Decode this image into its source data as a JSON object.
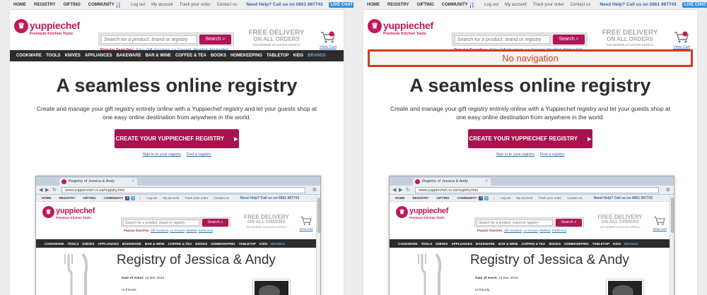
{
  "top_nav": {
    "home": "HOME",
    "registry": "REGISTRY",
    "gifting": "GIFTING",
    "community": "COMMUNITY",
    "log_out": "Log out",
    "my_account": "My account",
    "track_order": "Track your order",
    "contact_us": "Contact us",
    "help": "Need Help? Call us on 0861 987743",
    "live_chat": "LIVE CHAT"
  },
  "logo": {
    "name": "yuppiechef",
    "tagline": "Premium Kitchen Tools",
    "icon": "chef-hat-icon"
  },
  "search": {
    "placeholder": "Search for a product, brand or registry",
    "button": "Search",
    "popular_label": "Popular Searches:",
    "popular_items": [
      "Zoku",
      "Gift Vouchers",
      "Le Creuset",
      "Wusthof",
      "KitchenAid"
    ]
  },
  "delivery": {
    "line1": "FREE DELIVERY",
    "line2": "ON ALL ORDERS",
    "line3": "ANYWHERE IN SOUTH AFRICA"
  },
  "cart": {
    "label": "View Cart",
    "count": "0"
  },
  "categories": [
    "COOKWARE",
    "TOOLS",
    "KNIVES",
    "APPLIANCES",
    "BAKEWARE",
    "BAR & WINE",
    "COFFEE & TEA",
    "BOOKS",
    "HOMEKEEPING",
    "TABLETOP",
    "KIDS",
    "BRANDS"
  ],
  "annotation": {
    "no_navigation": "No navigation"
  },
  "hero": {
    "title": "A seamless online registry",
    "description": "Create and manage your gift registry entirely online with a Yuppiechef registry and let your guests shop at one easy online destination from anywhere in the world.",
    "cta": "CREATE YOUR YUPPIECHEF REGISTRY",
    "sign_in": "Sign in to your registry",
    "find": "Find a registry"
  },
  "browser": {
    "tab_title": "Registry of Jessica & Andy",
    "url": "www.yuppiechef.co.za/registry.htm",
    "registry_title": "Registry of Jessica & Andy",
    "date_label": "Date of event:",
    "date_value": "13 Dec 2010",
    "greeting": "Hi friends,"
  },
  "colors": {
    "brand": "#c0185a",
    "cta": "#a8134f",
    "nav": "#2c2c2c",
    "link": "#2b6cb0",
    "annotation": "#d63a1e"
  }
}
